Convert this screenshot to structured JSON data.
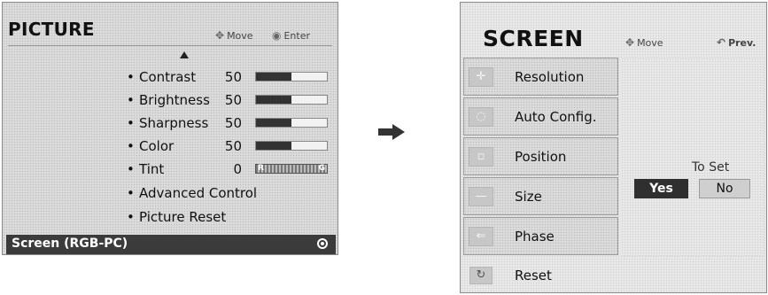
{
  "picture_menu": {
    "title": "PICTURE",
    "hint_move": "Move",
    "hint_enter": "Enter",
    "items": [
      {
        "label": "Contrast",
        "value": "50",
        "level": 0.5
      },
      {
        "label": "Brightness",
        "value": "50",
        "level": 0.5
      },
      {
        "label": "Sharpness",
        "value": "50",
        "level": 0.5
      },
      {
        "label": "Color",
        "value": "50",
        "level": 0.5
      },
      {
        "label": "Tint",
        "value": "0",
        "tint_left": "R",
        "tint_right": "G"
      },
      {
        "label": "Advanced Control"
      },
      {
        "label": "Picture Reset"
      }
    ],
    "selected_item": "Screen (RGB-PC)"
  },
  "screen_menu": {
    "title": "SCREEN",
    "hint_move": "Move",
    "hint_prev": "Prev.",
    "items": [
      {
        "label": "Resolution",
        "icon": "resolution-icon"
      },
      {
        "label": "Auto Config.",
        "icon": "auto-config-icon"
      },
      {
        "label": "Position",
        "icon": "position-icon"
      },
      {
        "label": "Size",
        "icon": "size-icon"
      },
      {
        "label": "Phase",
        "icon": "phase-icon"
      }
    ],
    "reset_label": "Reset",
    "confirm_prompt": "To Set",
    "yes_label": "Yes",
    "no_label": "No"
  }
}
